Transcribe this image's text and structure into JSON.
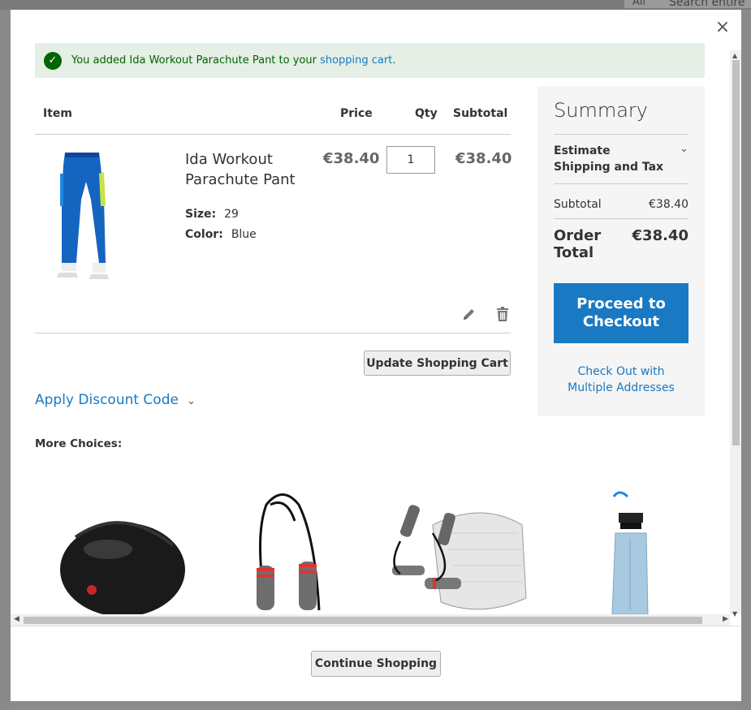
{
  "background": {
    "search_scope": "All",
    "search_placeholder": "Search entire"
  },
  "modal": {
    "close_label": "×",
    "message": {
      "prefix": "You added Ida Workout Parachute Pant to your ",
      "link": "shopping cart",
      "suffix": "."
    },
    "table_headers": {
      "item": "Item",
      "price": "Price",
      "qty": "Qty",
      "subtotal": "Subtotal"
    },
    "cart_item": {
      "name": "Ida Workout Parachute Pant",
      "price": "€38.40",
      "qty": "1",
      "subtotal": "€38.40",
      "options": [
        {
          "label": "Size:",
          "value": "29"
        },
        {
          "label": "Color:",
          "value": "Blue"
        }
      ]
    },
    "update_button": "Update Shopping Cart",
    "discount_label": "Apply Discount Code",
    "more_choices": "More Choices:",
    "summary": {
      "title": "Summary",
      "estimate": "Estimate Shipping and Tax",
      "subtotal_label": "Subtotal",
      "subtotal_value": "€38.40",
      "order_total_label": "Order Total",
      "order_total_value": "€38.40",
      "checkout_button": "Proceed to Checkout",
      "multi_address": "Check Out with Multiple Addresses"
    },
    "continue_button": "Continue Shopping"
  },
  "colors": {
    "accent": "#1979c3",
    "success_bg": "#e5efe5",
    "success_text": "#006400"
  }
}
